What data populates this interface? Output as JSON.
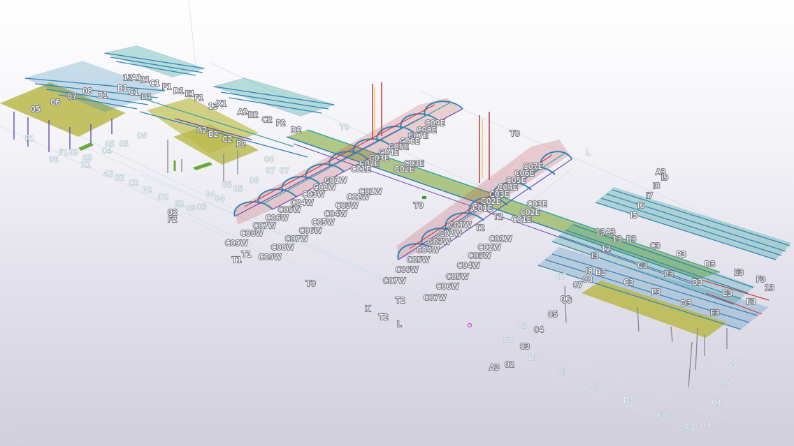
{
  "colors": {
    "background_top": "#ffffff",
    "background_bottom": "#d2cfdd",
    "roof_green": "#b8b84a",
    "steel_blue": "#2f84b5",
    "steel_teal": "#3aa7a0",
    "steel_red": "#c2404a",
    "steel_purple": "#6a4bb0",
    "grid_line": "#cfe1e6",
    "label_white": "#ffffff"
  },
  "grid_labels": {
    "near_rows": [
      "T0",
      "K",
      "T2",
      "L"
    ],
    "lower_right_rows": [
      "A3",
      "02",
      "03",
      "04",
      "05",
      "06",
      "A3",
      "B3",
      "C3",
      "P3",
      "D3",
      "E3",
      "F3",
      "03",
      "04",
      "05",
      "06"
    ],
    "upper_right_rows": [
      "A3",
      "I9",
      "I8",
      "I7",
      "I6",
      "I5"
    ],
    "left_rows": [
      "A2",
      "B2",
      "C2",
      "P2",
      "D2",
      "E2",
      "F2",
      "02",
      "03",
      "04",
      "05",
      "06",
      "07",
      "X1",
      "02",
      "03"
    ],
    "tower_labels": [
      "T0",
      "T1",
      "T2",
      "K",
      "L",
      "T0",
      "T1"
    ]
  },
  "west_tube_members": [
    "C09E",
    "C08E",
    "C07E",
    "C06E",
    "C05E",
    "C04E",
    "C03E",
    "C02E",
    "C01E",
    "C01W",
    "C02W",
    "C03W",
    "C04W",
    "C05W",
    "C06W",
    "C07W",
    "C08W",
    "C09W",
    "C09W",
    "C08W",
    "C07W",
    "C06W",
    "C05W",
    "C04W",
    "C03W",
    "C02W",
    "C01W",
    "C02E",
    "C03E"
  ],
  "east_tube_members": [
    "C07E",
    "C06E",
    "C05E",
    "C04E",
    "C03E",
    "C02E",
    "C01E",
    "C01W",
    "C02W",
    "C03W",
    "C04W",
    "C05W",
    "C06W",
    "C07W",
    "C06W",
    "C05W",
    "C04W",
    "C03W",
    "C02W",
    "C01W",
    "C02E",
    "C03E",
    "C01E"
  ],
  "west_building_labels": [
    "13",
    "A1",
    "B1",
    "C1",
    "P1",
    "D1",
    "E1",
    "F1",
    "13",
    "X1",
    "A2",
    "B2",
    "C2",
    "P2",
    "D2",
    "A2",
    "B2",
    "C2",
    "P2",
    "05",
    "06",
    "07",
    "08",
    "B1",
    "C1",
    "D1",
    "05",
    "04",
    "P1",
    "F1",
    "03",
    "02",
    "06",
    "07"
  ],
  "east_building_labels": [
    "A3",
    "13",
    "12",
    "I3",
    "B3",
    "C3",
    "P3",
    "D3",
    "E3",
    "F3",
    "C3",
    "P3",
    "D3",
    "E3",
    "C3",
    "P3",
    "D3",
    "E3",
    "F3",
    "13",
    "I8",
    "B3",
    "07",
    "08",
    "06"
  ]
}
